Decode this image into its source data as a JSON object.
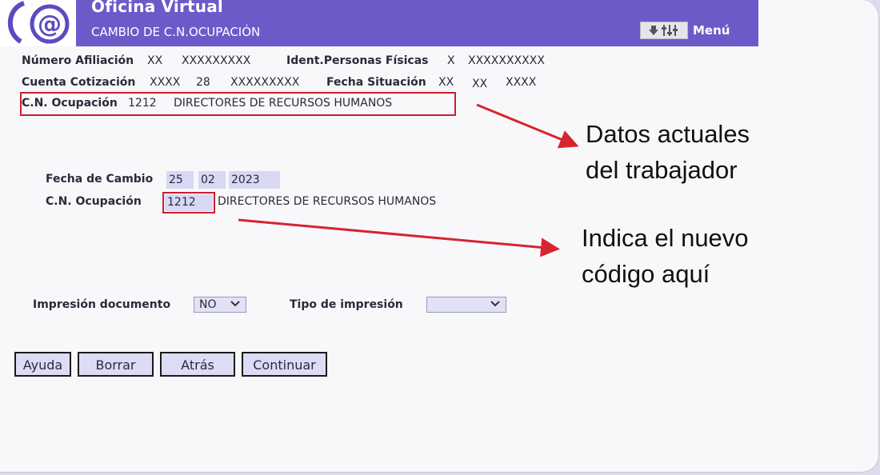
{
  "header": {
    "title": "Oficina Virtual",
    "subtitle": "CAMBIO DE C.N.OCUPACIÓN",
    "menu_label": "Menú",
    "brand_color": "#6b5bc9"
  },
  "info": {
    "afiliacion_label": "Número Afiliación",
    "afiliacion_a": "XX",
    "afiliacion_b": "XXXXXXXXX",
    "ipf_label": "Ident.Personas Físicas",
    "ipf_a": "X",
    "ipf_b": "XXXXXXXXXX",
    "cuenta_label": "Cuenta Cotización",
    "cuenta_a": "XXXX",
    "cuenta_b": "28",
    "cuenta_c": "XXXXXXXXX",
    "fecha_sit_label": "Fecha Situación",
    "fecha_sit_a": "XX",
    "fecha_sit_b": "XX",
    "fecha_sit_c": "XXXX",
    "cno_label": "C.N. Ocupación",
    "cno_code": "1212",
    "cno_desc": "DIRECTORES DE RECURSOS HUMANOS"
  },
  "form": {
    "fecha_cambio_label": "Fecha de Cambio",
    "fecha_day": "25",
    "fecha_month": "02",
    "fecha_year": "2023",
    "cno_label": "C.N. Ocupación",
    "cno_code": "1212",
    "cno_desc": "DIRECTORES DE RECURSOS HUMANOS",
    "impresion_label": "Impresión documento",
    "impresion_value": "NO",
    "tipo_label": "Tipo de impresión",
    "tipo_value": ""
  },
  "buttons": {
    "ayuda": "Ayuda",
    "borrar": "Borrar",
    "atras": "Atrás",
    "continuar": "Continuar"
  },
  "annotations": {
    "note1_line1": "Datos actuales",
    "note1_line2": "del trabajador",
    "note2_line1": "Indica el nuevo",
    "note2_line2": "código aquí",
    "highlight_color": "#c8202a"
  }
}
